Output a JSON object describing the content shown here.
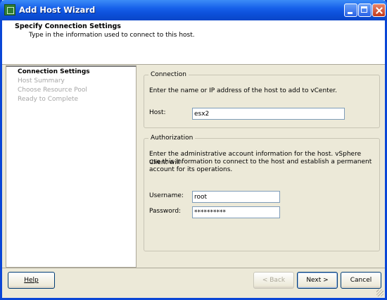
{
  "window": {
    "title": "Add Host Wizard"
  },
  "header": {
    "title": "Specify Connection Settings",
    "subtitle": "Type in the information used to connect to this host."
  },
  "steps": [
    {
      "label": "Connection Settings",
      "active": true
    },
    {
      "label": "Host Summary",
      "active": false
    },
    {
      "label": "Choose Resource Pool",
      "active": false
    },
    {
      "label": "Ready to Complete",
      "active": false
    }
  ],
  "connection": {
    "legend": "Connection",
    "description": "Enter the name or IP address of the host to add to vCenter.",
    "host_label": "Host:",
    "host_value": "esx2"
  },
  "authorization": {
    "legend": "Authorization",
    "description_lines": [
      "Enter the administrative account information for the host. vSphere Client will",
      "use this information to connect to the host and establish a permanent",
      "account for its operations."
    ],
    "username_label": "Username:",
    "username_value": "root",
    "password_label": "Password:",
    "password_value": "**********"
  },
  "buttons": {
    "help": "Help",
    "back": "< Back",
    "next": "Next >",
    "cancel": "Cancel"
  },
  "colors": {
    "titlebar": "#0c4fd8",
    "dialog_bg": "#ece9d8"
  }
}
